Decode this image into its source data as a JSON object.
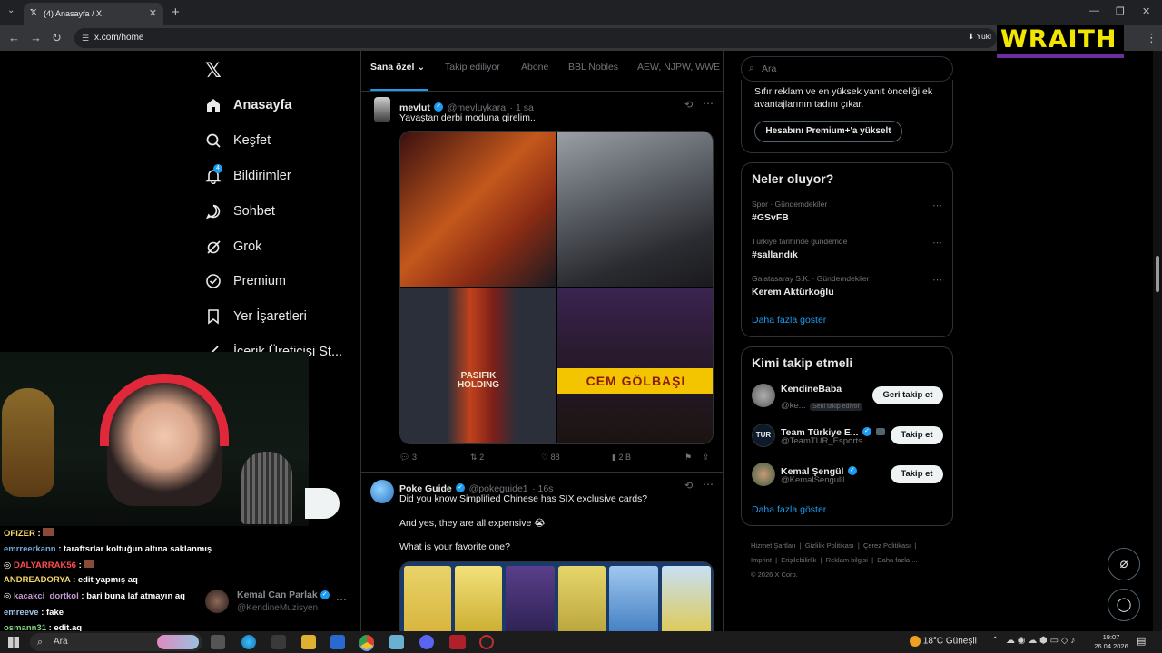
{
  "browser": {
    "tab_title": "(4) Anasayfa / X",
    "url": "x.com/home",
    "extension_label": "Yükl"
  },
  "overlay": {
    "brand_logo": "WRAITH"
  },
  "sidebar": {
    "items": [
      {
        "label": "Anasayfa",
        "icon": "home-icon"
      },
      {
        "label": "Keşfet",
        "icon": "search-icon"
      },
      {
        "label": "Bildirimler",
        "icon": "bell-icon",
        "badge": "4"
      },
      {
        "label": "Sohbet",
        "icon": "chat-icon"
      },
      {
        "label": "Grok",
        "icon": "grok-icon"
      },
      {
        "label": "Premium",
        "icon": "premium-icon"
      },
      {
        "label": "Yer İşaretleri",
        "icon": "bookmark-icon"
      },
      {
        "label": "İçerik Üreticisi St...",
        "icon": "creator-icon"
      }
    ],
    "account": {
      "name": "Kemal Can Parlak",
      "handle": "@KendineMuzisyen"
    }
  },
  "timeline": {
    "tabs": [
      "Sana özel",
      "Takip ediliyor",
      "Abone",
      "BBL Nobles",
      "AEW, NJPW, WWE T..."
    ],
    "tweets": [
      {
        "name": "mevlut",
        "handle": "@mevluykara",
        "time": "· 1 sa",
        "text": "Yavaştan derbi moduna girelim..",
        "image_captions": [
          "PASIFIK HOLDING",
          "CEM GÖLBAŞI"
        ],
        "replies": "3",
        "reposts": "2",
        "likes": "88",
        "views": "2 B"
      },
      {
        "name": "Poke Guide",
        "handle": "@pokeguide1",
        "time": "· 16s",
        "text_lines": [
          "Did you know Simplified Chinese has SIX exclusive cards?",
          "And yes, they are all expensive 😭",
          "What is your favorite one?"
        ]
      }
    ]
  },
  "right": {
    "search_placeholder": "Ara",
    "premium": {
      "text": "Sıfır reklam ve en yüksek yanıt önceliği ek avantajlarının tadını çıkar.",
      "button": "Hesabını Premium+'a yükselt"
    },
    "trends": {
      "title": "Neler oluyor?",
      "items": [
        {
          "meta": "Spor · Gündemdekiler",
          "name": "#GSvFB"
        },
        {
          "meta": "Türkiye tarihinde gündemde",
          "name": "#sallandık"
        },
        {
          "meta": "Galatasaray S.K. · Gündemdekiler",
          "name": "Kerem Aktürkoğlu"
        }
      ],
      "more": "Daha fazla göster"
    },
    "who_to_follow": {
      "title": "Kimi takip etmeli",
      "items": [
        {
          "name": "KendineBaba",
          "handle": "@ke...",
          "tag": "Seni takip ediyor",
          "button": "Geri takip et"
        },
        {
          "name": "Team Türkiye E...",
          "handle": "@TeamTUR_Esports",
          "avatar_text": "TUR",
          "button": "Takip et"
        },
        {
          "name": "Kemal Şengül",
          "handle": "@KemalSengulll",
          "button": "Takip et"
        }
      ],
      "more": "Daha fazla göster"
    },
    "footer": [
      "Hizmet Şartları",
      "Gizlilik Politikası",
      "Çerez Politikası",
      "Imprint",
      "Erişilebilirlik",
      "Reklam bilgisi",
      "Daha fazla ...",
      "© 2026 X Corp."
    ]
  },
  "chat": [
    {
      "user": "OFIZER",
      "msg": "",
      "color": "#f5d76e"
    },
    {
      "user": "emrreerkann",
      "msg": "taraftsrlar koltuğun altına saklanmış",
      "color": "#6fa8dc"
    },
    {
      "user": "DALYARRAK56",
      "msg": "",
      "color": "#ff4d4d"
    },
    {
      "user": "ANDREADORYA",
      "msg": "edit yapmış aq",
      "color": "#f5d76e"
    },
    {
      "user": "kacakci_dortkol",
      "msg": "bari buna laf atmayın aq",
      "color": "#c39bd3"
    },
    {
      "user": "emreeve",
      "msg": "fake",
      "color": "#9fc5e8"
    },
    {
      "user": "osmann31",
      "msg": "edit.aq",
      "color": "#7fd37f"
    }
  ],
  "taskbar": {
    "search": "Ara",
    "weather": "18°C  Güneşli",
    "time": "19:07",
    "date": "26.04.2026"
  },
  "colors": {
    "accent": "#1d9bf0",
    "background": "#000000",
    "border": "#2f3336",
    "brand_yellow": "#f2e600",
    "brand_purple": "#6b2fa0"
  }
}
